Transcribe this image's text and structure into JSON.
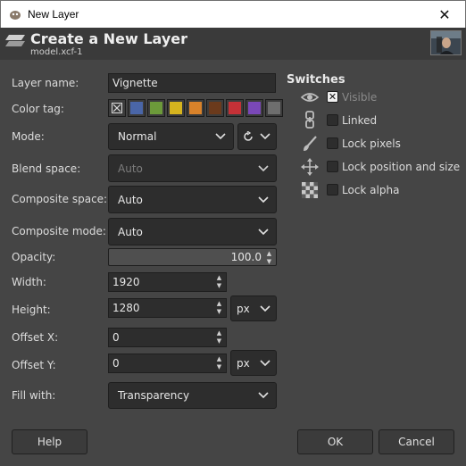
{
  "window": {
    "title": "New Layer",
    "close_glyph": "✕"
  },
  "header": {
    "title": "Create a New Layer",
    "subtitle": "model.xcf-1"
  },
  "form": {
    "layer_name_label": "Layer name:",
    "layer_name_value": "Vignette",
    "color_tag_label": "Color tag:",
    "color_tags": [
      {
        "name": "none",
        "color": ""
      },
      {
        "name": "blue",
        "color": "#4a66a8"
      },
      {
        "name": "green",
        "color": "#6c9a3a"
      },
      {
        "name": "yellow",
        "color": "#d6b41e"
      },
      {
        "name": "orange",
        "color": "#d9822a"
      },
      {
        "name": "brown",
        "color": "#6b3a1c"
      },
      {
        "name": "red",
        "color": "#c53137"
      },
      {
        "name": "violet",
        "color": "#7a48b8"
      },
      {
        "name": "gray",
        "color": "#6e6e6e"
      }
    ],
    "mode_label": "Mode:",
    "mode_value": "Normal",
    "blend_space_label": "Blend space:",
    "blend_space_value": "Auto",
    "composite_space_label": "Composite space:",
    "composite_space_value": "Auto",
    "composite_mode_label": "Composite mode:",
    "composite_mode_value": "Auto",
    "opacity_label": "Opacity:",
    "opacity_value": "100.0",
    "opacity_fraction": 1.0,
    "width_label": "Width:",
    "width_value": "1920",
    "height_label": "Height:",
    "height_value": "1280",
    "unit_value": "px",
    "offset_x_label": "Offset X:",
    "offset_x_value": "0",
    "offset_y_label": "Offset Y:",
    "offset_y_value": "0",
    "offset_unit_value": "px",
    "fill_label": "Fill with:",
    "fill_value": "Transparency"
  },
  "switches": {
    "title": "Switches",
    "items": [
      {
        "icon": "eye-icon",
        "label": "Visible",
        "checked": true
      },
      {
        "icon": "chain-link-icon",
        "label": "Linked",
        "checked": false
      },
      {
        "icon": "paintbrush-icon",
        "label": "Lock pixels",
        "checked": false
      },
      {
        "icon": "move-arrows-icon",
        "label": "Lock position and size",
        "checked": false
      },
      {
        "icon": "checkerboard-icon",
        "label": "Lock alpha",
        "checked": false
      }
    ]
  },
  "buttons": {
    "help": "Help",
    "ok": "OK",
    "cancel": "Cancel"
  },
  "colors": {
    "background": "#454545",
    "header": "#3a3a3a",
    "field": "#2d2d2d"
  }
}
